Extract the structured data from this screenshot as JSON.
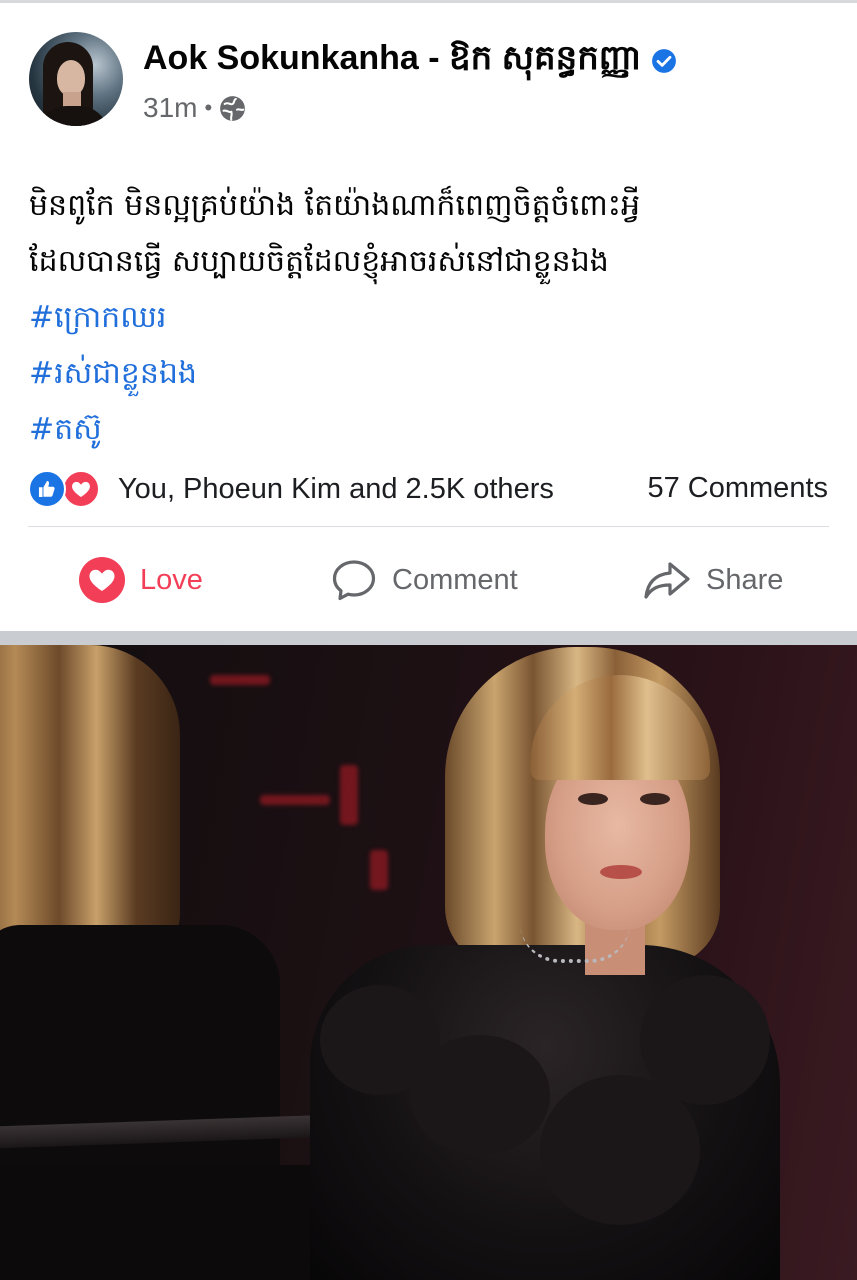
{
  "post": {
    "author": "Aok Sokunkanha - ឱក សុគន្ធកញ្ញា",
    "time": "31m",
    "dot": "•",
    "body_lines": [
      "មិនពូកែ មិនល្អគ្រប់យ៉ាង តែយ៉ាងណាក៏ពេញចិត្តចំពោះអ្វី",
      "ដែលបានធ្វើ សប្បាយចិត្តដែលខ្ញុំអាចរស់នៅជាខ្លួនឯង"
    ],
    "hashtags": [
      "#ក្រោកឈរ",
      "#រស់ជាខ្លួនឯង",
      "#តស៊ូ"
    ]
  },
  "reactions": {
    "summary": "You, Phoeun Kim and 2.5K others",
    "comments": "57 Comments"
  },
  "actions": {
    "love_label": "Love",
    "comment_label": "Comment",
    "share_label": "Share"
  },
  "colors": {
    "love": "#f33e58",
    "like": "#1b74e4",
    "hashtag": "#216fdb",
    "muted": "#65676b"
  },
  "icons": [
    "verified-icon",
    "globe-icon",
    "like-reaction-icon",
    "love-reaction-icon",
    "heart-icon",
    "comment-bubble-icon",
    "share-arrow-icon"
  ]
}
